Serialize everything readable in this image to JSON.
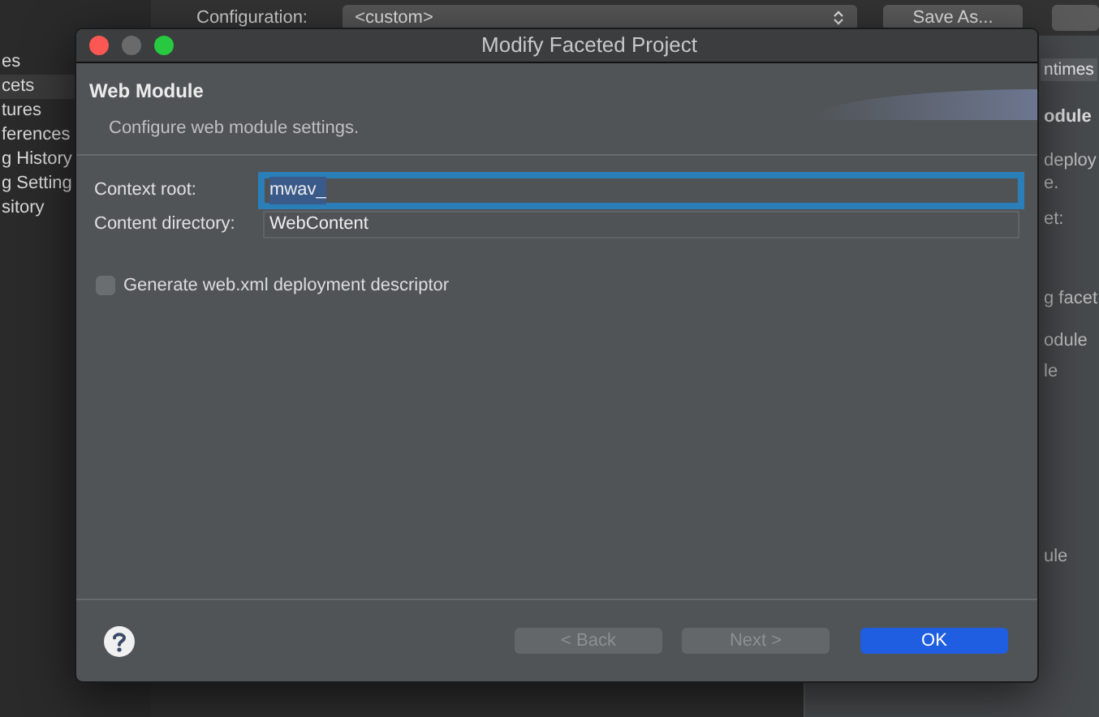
{
  "background": {
    "sidebar_items": [
      {
        "label": "es",
        "selected": false
      },
      {
        "label": "cets",
        "selected": true
      },
      {
        "label": "tures",
        "selected": false
      },
      {
        "label": "ferences",
        "selected": false
      },
      {
        "label": "g History",
        "selected": false
      },
      {
        "label": "g Setting",
        "selected": false
      },
      {
        "label": "sitory",
        "selected": false
      }
    ],
    "configuration": {
      "label": "Configuration:",
      "value": "<custom>",
      "save_button": "Save As..."
    },
    "right_panel": {
      "tab": "ntimes",
      "heading": "odule",
      "texts": [
        "deploy",
        "e.",
        "et:",
        "g facet",
        "odule",
        "le",
        "ule"
      ]
    }
  },
  "dialog": {
    "title": "Modify Faceted Project",
    "heading": "Web Module",
    "description": "Configure web module settings.",
    "fields": [
      {
        "label": "Context root:",
        "value": "mwav_",
        "focused": true
      },
      {
        "label": "Content directory:",
        "value": "WebContent",
        "focused": false
      }
    ],
    "checkbox": {
      "label": "Generate web.xml deployment descriptor",
      "checked": false
    },
    "buttons": [
      {
        "label": "< Back",
        "disabled": true,
        "primary": false
      },
      {
        "label": "Next >",
        "disabled": true,
        "primary": false
      },
      {
        "label": "OK",
        "disabled": false,
        "primary": true
      }
    ]
  }
}
